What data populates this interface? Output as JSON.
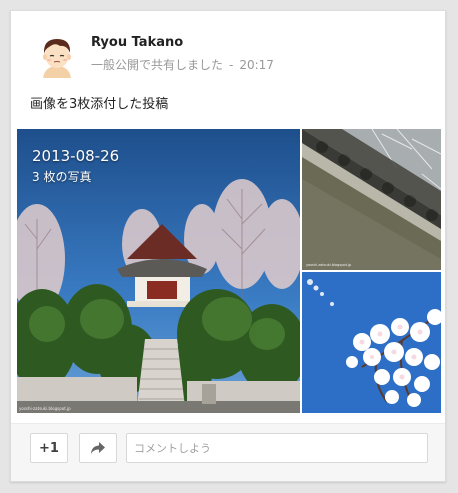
{
  "post": {
    "author_name": "Ryou Takano",
    "visibility": "一般公開で共有しました",
    "separator": "-",
    "time": "20:17",
    "text": "画像を3枚添付した投稿"
  },
  "album": {
    "date": "2013-08-26",
    "count_label": "3 枚の写真",
    "watermark_main": "yosshi-zatsuki.blogspot.jp",
    "watermark_side": "yosshi-zatsuki.blogspot.jp"
  },
  "actions": {
    "plus_one_label": "+1",
    "share_icon": "share-arrow-icon",
    "comment_placeholder": "コメントしよう"
  },
  "colors": {
    "page_bg": "#e5e5e5",
    "card_bg": "#ffffff",
    "actions_bg": "#f6f6f6",
    "sky": "#2c66a8"
  }
}
